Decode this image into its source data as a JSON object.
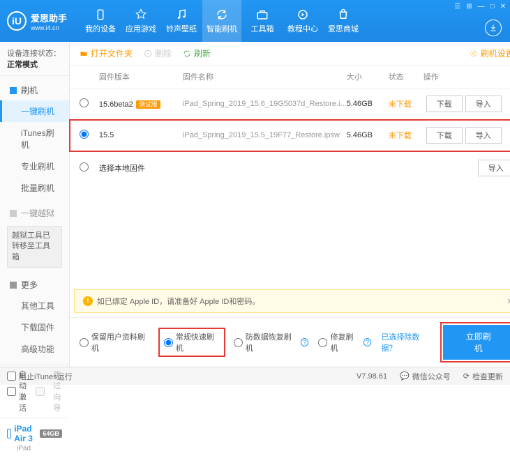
{
  "header": {
    "logo_letter": "iU",
    "app_name": "爱思助手",
    "url": "www.i4.cn",
    "nav": [
      {
        "label": "我的设备"
      },
      {
        "label": "应用游戏"
      },
      {
        "label": "铃声壁纸"
      },
      {
        "label": "智能刷机"
      },
      {
        "label": "工具箱"
      },
      {
        "label": "教程中心"
      },
      {
        "label": "爱思商城"
      }
    ]
  },
  "sidebar": {
    "status_label": "设备连接状态：",
    "status_value": "正常模式",
    "group1_head": "刷机",
    "items1": [
      "一键刷机",
      "iTunes刷机",
      "专业刷机",
      "批量刷机"
    ],
    "jailbreak_head": "一键越狱",
    "jailbreak_note": "越狱工具已转移至工具箱",
    "group2_head": "更多",
    "items2": [
      "其他工具",
      "下载固件",
      "高级功能"
    ],
    "auto_activate": "自动激活",
    "skip_guide": "跳过向导",
    "device_name": "iPad Air 3",
    "device_storage": "64GB",
    "device_type": "iPad"
  },
  "toolbar": {
    "open": "打开文件夹",
    "delete": "删除",
    "refresh": "刷新",
    "settings": "刷机设置"
  },
  "columns": {
    "ver": "固件版本",
    "name": "固件名称",
    "size": "大小",
    "status": "状态",
    "ops": "操作"
  },
  "rows": [
    {
      "version": "15.6beta2",
      "tag": "测试版",
      "file": "iPad_Spring_2019_15.6_19G5037d_Restore.i...",
      "size": "5.46GB",
      "status": "未下载"
    },
    {
      "version": "15.5",
      "tag": "",
      "file": "iPad_Spring_2019_15.5_19F77_Restore.ipsw",
      "size": "5.46GB",
      "status": "未下载"
    }
  ],
  "btn_download": "下载",
  "btn_import": "导入",
  "local_firmware": "选择本地固件",
  "alert_text": "如已绑定 Apple ID，请准备好 Apple ID和密码。",
  "options": [
    {
      "label": "保留用户资料刷机"
    },
    {
      "label": "常规快速刷机"
    },
    {
      "label": "防数据恢复刷机"
    },
    {
      "label": "修复刷机"
    }
  ],
  "exclude_link": "已选择除数据？",
  "flash_btn": "立即刷机",
  "statusbar": {
    "block_itunes": "阻止iTunes运行",
    "version": "V7.98.61",
    "wechat": "微信公众号",
    "update": "检查更新"
  }
}
